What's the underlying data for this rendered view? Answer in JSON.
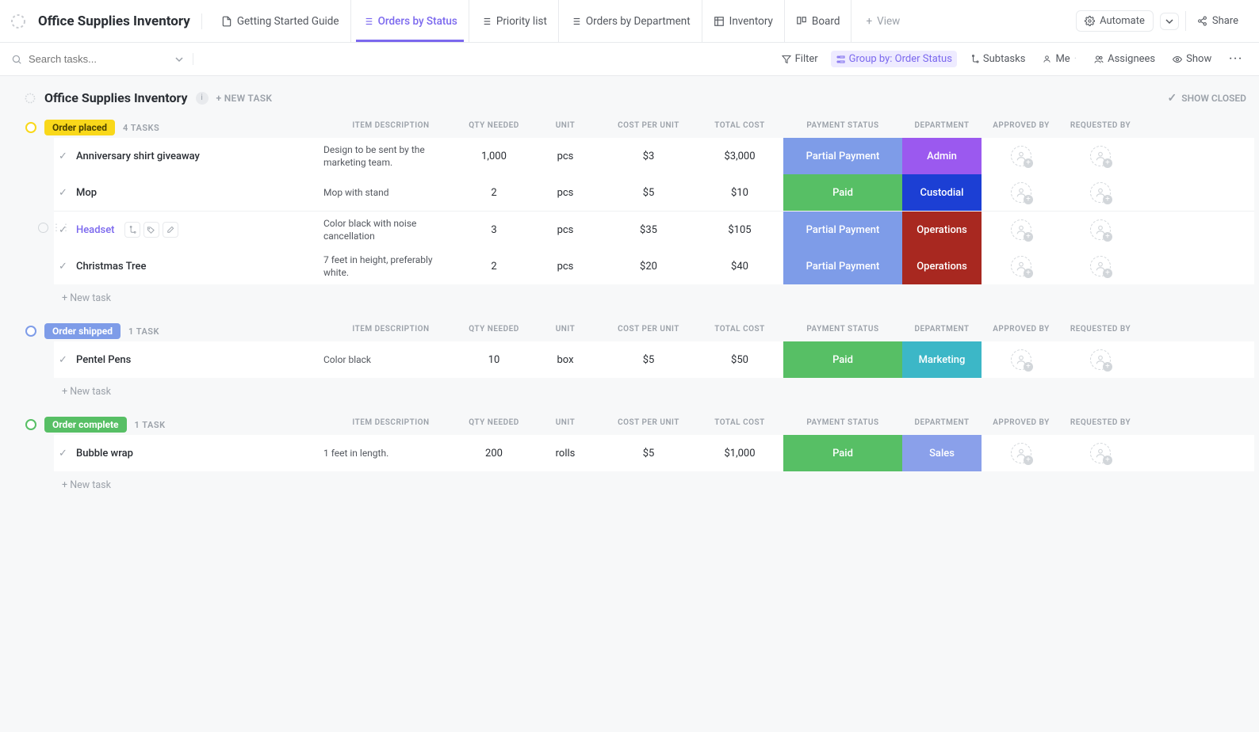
{
  "header": {
    "title": "Office Supplies Inventory",
    "tabs": [
      {
        "label": "Getting Started Guide",
        "icon": "doc"
      },
      {
        "label": "Orders by Status",
        "icon": "list",
        "active": true
      },
      {
        "label": "Priority list",
        "icon": "list"
      },
      {
        "label": "Orders by Department",
        "icon": "list"
      },
      {
        "label": "Inventory",
        "icon": "table"
      },
      {
        "label": "Board",
        "icon": "board"
      }
    ],
    "view_button": "View",
    "automate_button": "Automate",
    "share_button": "Share"
  },
  "toolbar": {
    "search_placeholder": "Search tasks...",
    "filter": "Filter",
    "groupby": "Group by: Order Status",
    "subtasks": "Subtasks",
    "me": "Me",
    "assignees": "Assignees",
    "show": "Show"
  },
  "list": {
    "title": "Office Supplies Inventory",
    "new_task": "+ NEW TASK",
    "show_closed": "SHOW CLOSED",
    "new_task_row": "+ New task"
  },
  "columns": {
    "desc": "ITEM DESCRIPTION",
    "qty": "QTY NEEDED",
    "unit": "UNIT",
    "cost_per_unit": "COST PER UNIT",
    "total_cost": "TOTAL COST",
    "payment_status": "PAYMENT STATUS",
    "department": "DEPARTMENT",
    "approved_by": "APPROVED BY",
    "requested_by": "REQUESTED BY"
  },
  "payment_status_colors": {
    "Partial Payment": "#7e9ce8",
    "Paid": "#57bf65"
  },
  "department_colors": {
    "Admin": "#9b59ef",
    "Custodial": "#1c3fd4",
    "Operations": "#a82820",
    "Marketing": "#3cb7c7",
    "Sales": "#8aa0ea"
  },
  "groups": [
    {
      "name": "Order placed",
      "count_label": "4 TASKS",
      "pill_bg": "#f9d81a",
      "pill_fg": "#4b4100",
      "circle": "#f9d81a",
      "tasks": [
        {
          "name": "Anniversary shirt giveaway",
          "desc": "Design to be sent by the marketing team.",
          "qty": "1,000",
          "unit": "pcs",
          "cpu": "$3",
          "total": "$3,000",
          "pay": "Partial Payment",
          "dept": "Admin"
        },
        {
          "name": "Mop",
          "desc": "Mop with stand",
          "qty": "2",
          "unit": "pcs",
          "cpu": "$5",
          "total": "$10",
          "pay": "Paid",
          "dept": "Custodial"
        },
        {
          "name": "Headset",
          "desc": "Color black with noise cancellation",
          "qty": "3",
          "unit": "pcs",
          "cpu": "$35",
          "total": "$105",
          "pay": "Partial Payment",
          "dept": "Operations",
          "hovered": true
        },
        {
          "name": "Christmas Tree",
          "desc": "7 feet in height, preferably white.",
          "qty": "2",
          "unit": "pcs",
          "cpu": "$20",
          "total": "$40",
          "pay": "Partial Payment",
          "dept": "Operations"
        }
      ]
    },
    {
      "name": "Order shipped",
      "count_label": "1 TASK",
      "pill_bg": "#7e9ce8",
      "pill_fg": "#ffffff",
      "circle": "#7e9ce8",
      "tasks": [
        {
          "name": "Pentel Pens",
          "desc": "Color black",
          "qty": "10",
          "unit": "box",
          "cpu": "$5",
          "total": "$50",
          "pay": "Paid",
          "dept": "Marketing"
        }
      ]
    },
    {
      "name": "Order complete",
      "count_label": "1 TASK",
      "pill_bg": "#57bf65",
      "pill_fg": "#ffffff",
      "circle": "#57bf65",
      "tasks": [
        {
          "name": "Bubble wrap",
          "desc": "1 feet in length.",
          "qty": "200",
          "unit": "rolls",
          "cpu": "$5",
          "total": "$1,000",
          "pay": "Paid",
          "dept": "Sales"
        }
      ]
    }
  ]
}
